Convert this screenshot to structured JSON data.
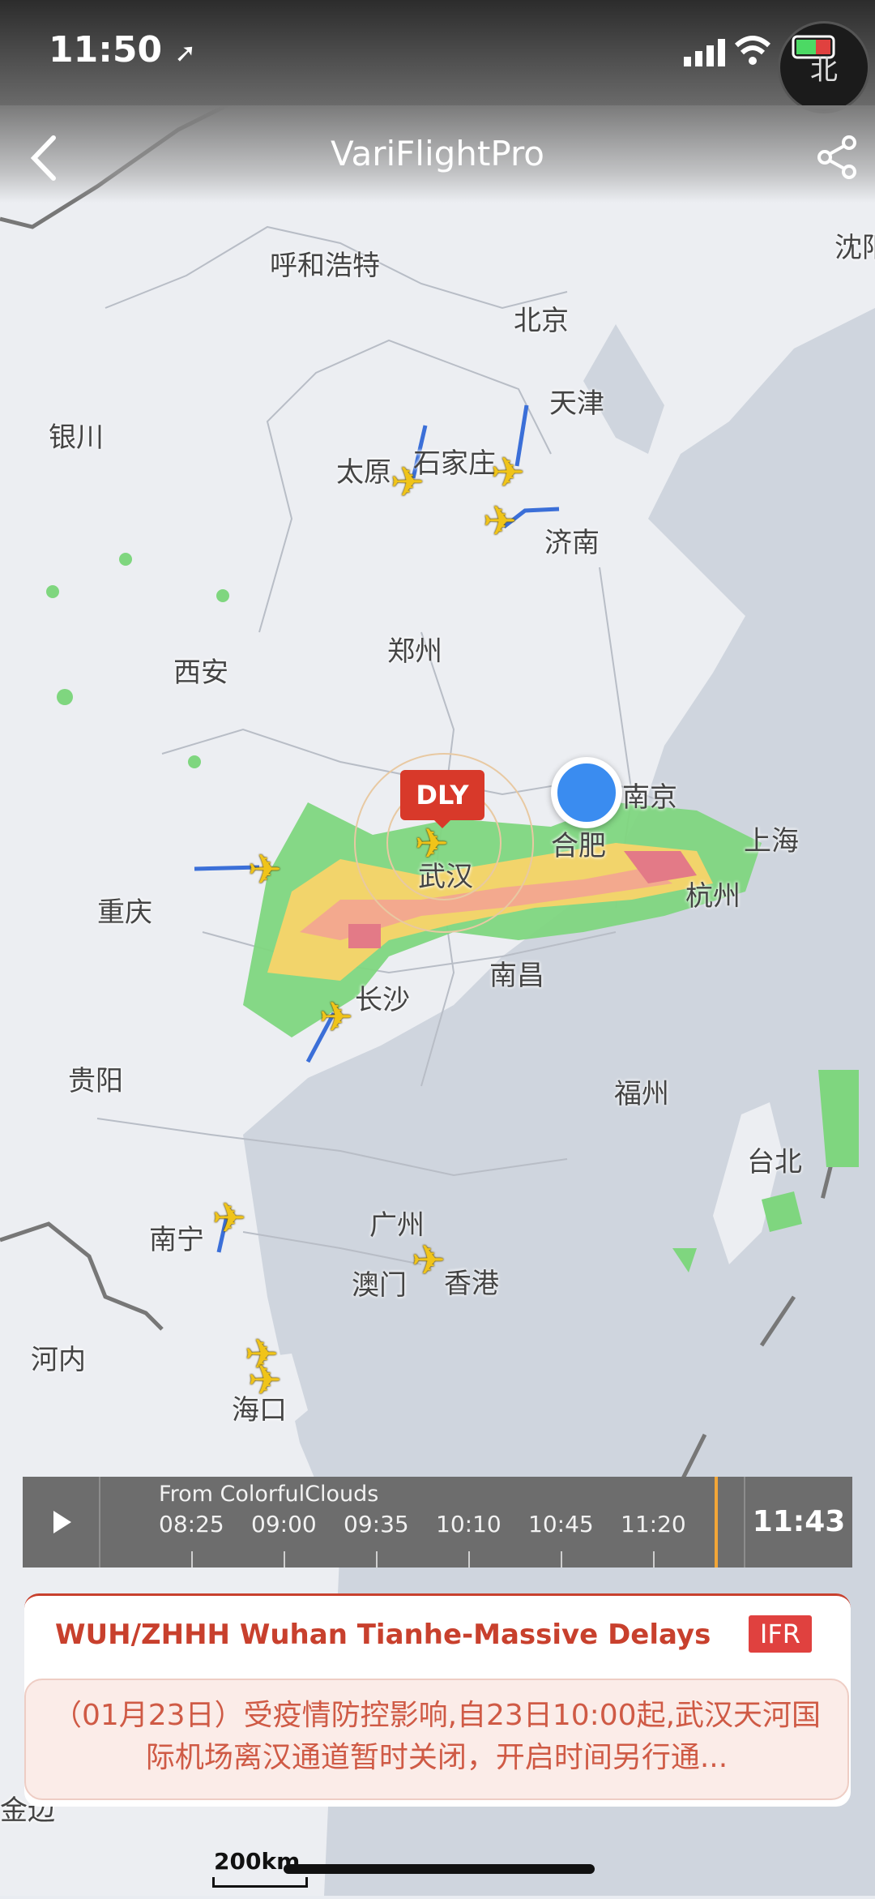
{
  "status_bar": {
    "time": "11:50",
    "compass_label": "北"
  },
  "nav": {
    "title": "VariFlightPro",
    "back_icon": "chevron-left-icon",
    "share_icon": "share-icon"
  },
  "cities": [
    {
      "id": "shenyang",
      "name": "沈阳"
    },
    {
      "id": "hohhot",
      "name": "呼和浩特"
    },
    {
      "id": "beijing",
      "name": "北京"
    },
    {
      "id": "tianjin",
      "name": "天津"
    },
    {
      "id": "yinchuan",
      "name": "银川"
    },
    {
      "id": "taiyuan",
      "name": "太原"
    },
    {
      "id": "shijiazhuang",
      "name": "石家庄"
    },
    {
      "id": "jinan",
      "name": "济南"
    },
    {
      "id": "zhengzhou",
      "name": "郑州"
    },
    {
      "id": "xian",
      "name": "西安"
    },
    {
      "id": "nanjing",
      "name": "南京"
    },
    {
      "id": "hefei",
      "name": "合肥"
    },
    {
      "id": "shanghai",
      "name": "上海"
    },
    {
      "id": "wuhan",
      "name": "武汉"
    },
    {
      "id": "hangzhou",
      "name": "杭州"
    },
    {
      "id": "chongqing",
      "name": "重庆"
    },
    {
      "id": "nanchang",
      "name": "南昌"
    },
    {
      "id": "changsha",
      "name": "长沙"
    },
    {
      "id": "guiyang",
      "name": "贵阳"
    },
    {
      "id": "fuzhou",
      "name": "福州"
    },
    {
      "id": "taipei",
      "name": "台北"
    },
    {
      "id": "nanning",
      "name": "南宁"
    },
    {
      "id": "guangzhou",
      "name": "广州"
    },
    {
      "id": "macau",
      "name": "澳门"
    },
    {
      "id": "hongkong",
      "name": "香港"
    },
    {
      "id": "hanoi",
      "name": "河内"
    },
    {
      "id": "haikou",
      "name": "海口"
    },
    {
      "id": "jinbian",
      "name": "金边"
    }
  ],
  "airport_marker": {
    "label": "DLY"
  },
  "timeline": {
    "source": "From ColorfulClouds",
    "ticks": [
      "08:25",
      "09:00",
      "09:35",
      "10:10",
      "10:45",
      "11:20"
    ],
    "current_time": "11:43"
  },
  "alert_card": {
    "title": "WUH/ZHHH Wuhan Tianhe-Massive Delays",
    "badge": "IFR",
    "notice": "（01月23日）受疫情防控影响,自23日10:00起,武汉天河国际机场离汉通道暂时关闭，开启时间另行通..."
  },
  "map_scale": {
    "label": "200km"
  },
  "colors": {
    "delay_red": "#d8392a",
    "location_blue": "#3a8cf0",
    "timeline_accent": "#f2a638",
    "plane_yellow": "#f0c419"
  }
}
